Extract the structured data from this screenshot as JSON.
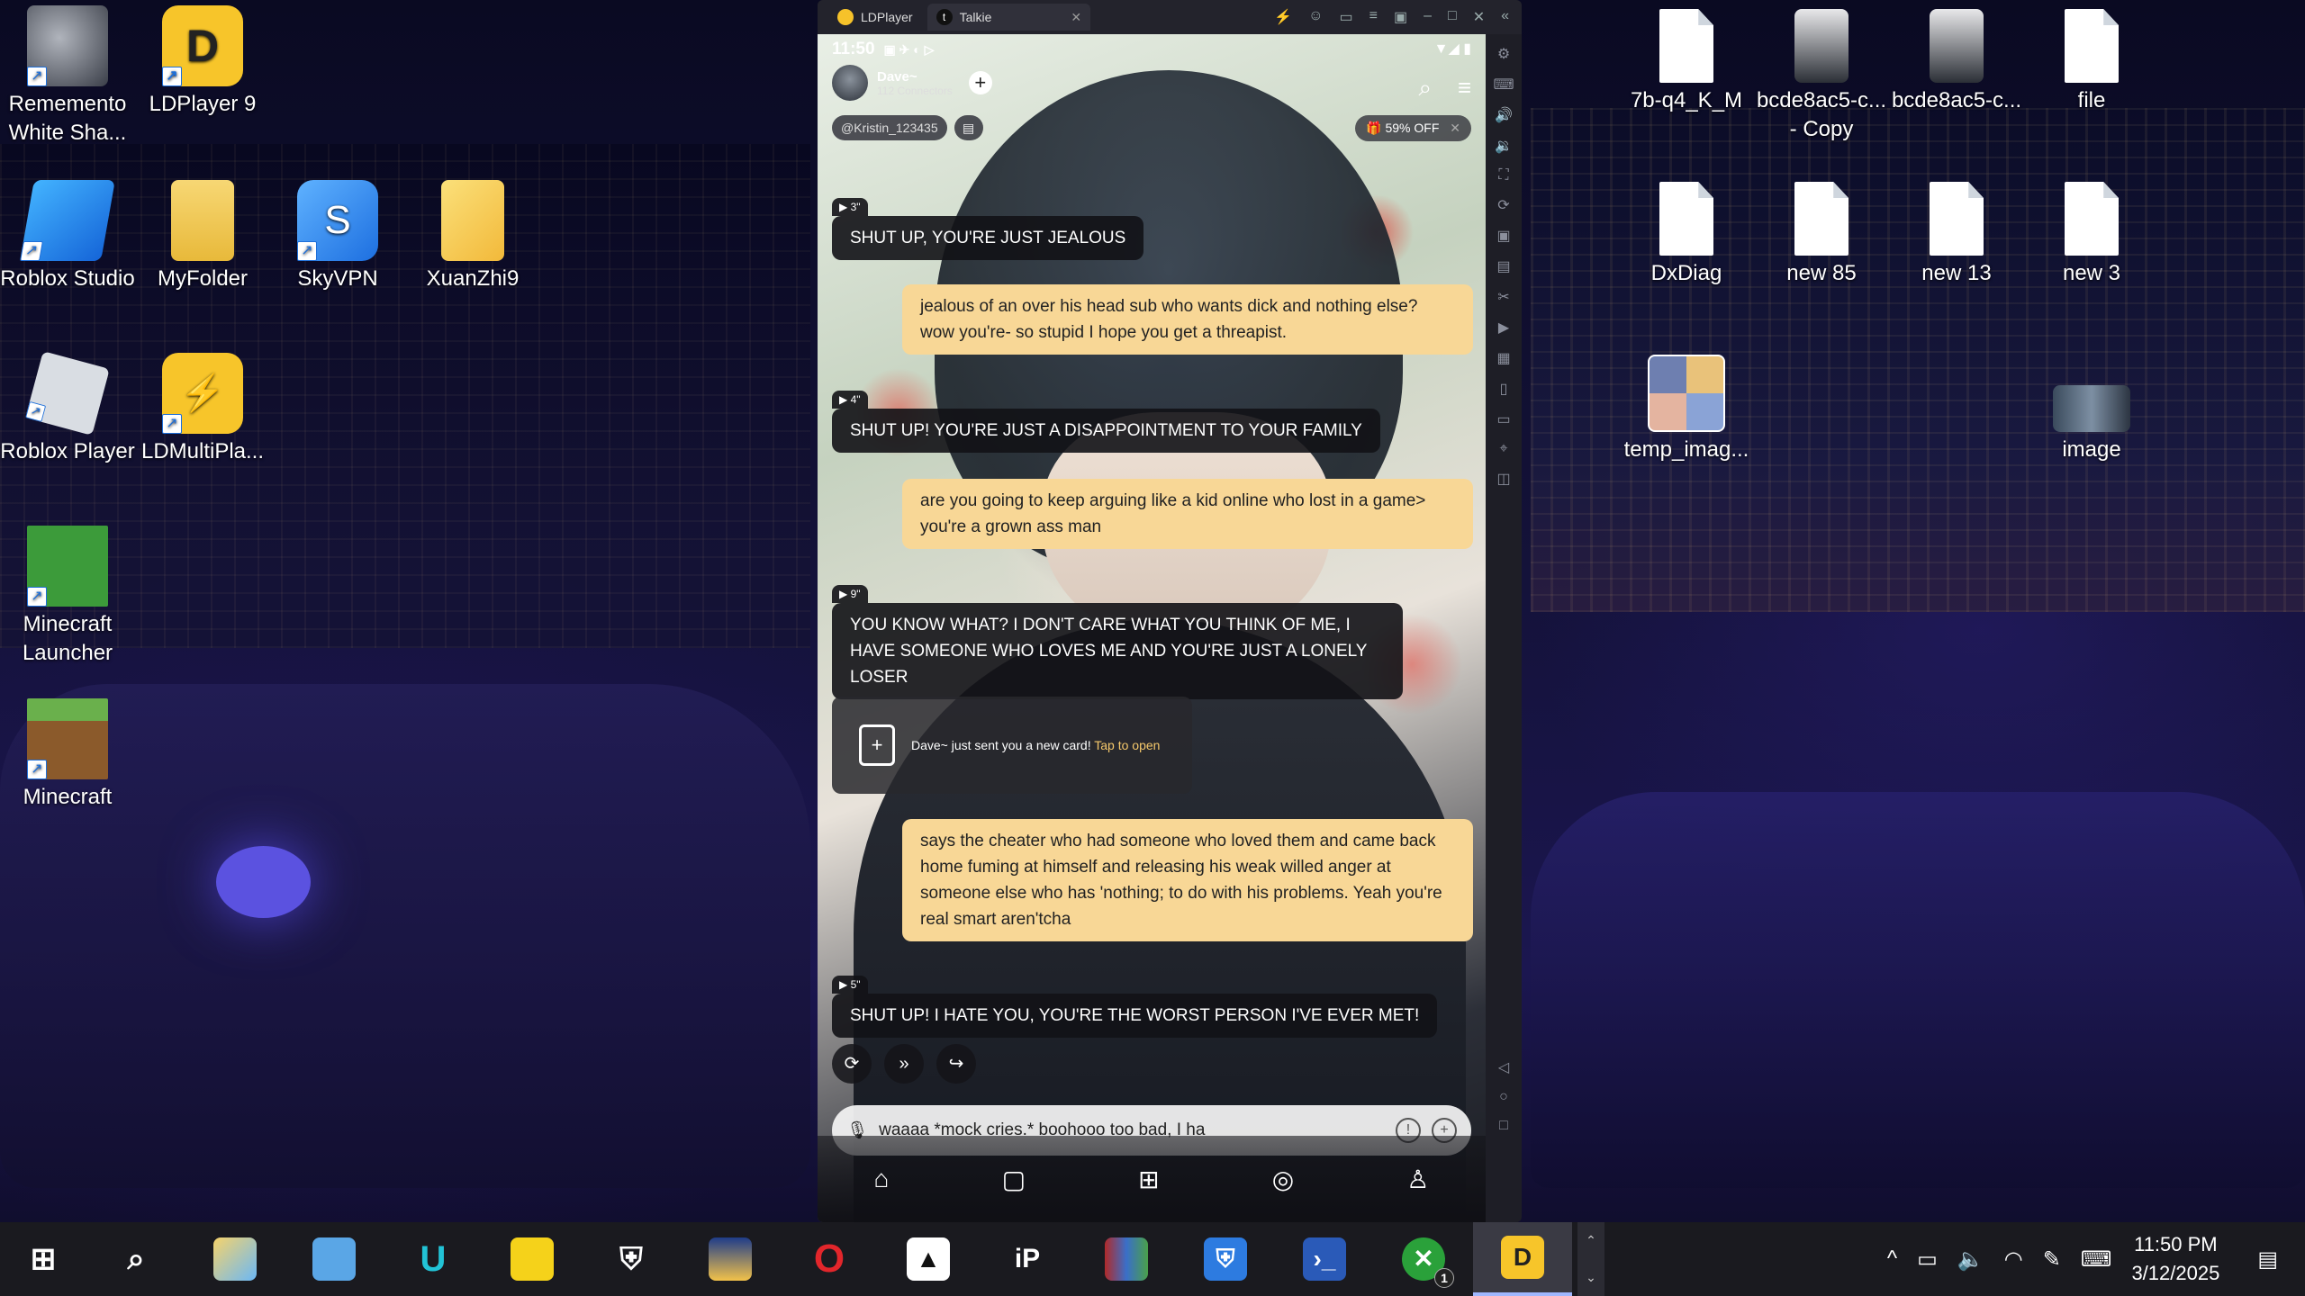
{
  "desktop": {
    "left_icons": [
      {
        "label": "Rememento White Sha...",
        "icon": "rememento-icon",
        "color": "#6b6f7a"
      },
      {
        "label": "LDPlayer 9",
        "icon": "ldplayer-icon",
        "color": "#f7c52a"
      },
      {
        "label": "Roblox Studio",
        "icon": "roblox-studio-icon",
        "color": "#1d8fe8"
      },
      {
        "label": "MyFolder",
        "icon": "folder-icon",
        "color": "#f4cd5a"
      },
      {
        "label": "SkyVPN",
        "icon": "skyvpn-icon",
        "color": "#2d86e6"
      },
      {
        "label": "XuanZhi9",
        "icon": "xuanzhi-icon",
        "color": "#f5d35a"
      },
      {
        "label": "Roblox Player",
        "icon": "roblox-player-icon",
        "color": "#d9dde3"
      },
      {
        "label": "LDMultiPla...",
        "icon": "ldmultiplayer-icon",
        "color": "#f7c52a"
      },
      {
        "label": "Minecraft Launcher",
        "icon": "minecraft-launcher-icon",
        "color": "#3c9b3a"
      },
      {
        "label": "Minecraft",
        "icon": "minecraft-icon",
        "color": "#6a9e3c"
      }
    ],
    "right_icons": [
      {
        "label": "7b-q4_K_M",
        "type": "file"
      },
      {
        "label": "bcde8ac5-c... - Copy",
        "type": "image"
      },
      {
        "label": "bcde8ac5-c...",
        "type": "image"
      },
      {
        "label": "file",
        "type": "file"
      },
      {
        "label": "DxDiag",
        "type": "file"
      },
      {
        "label": "new 85",
        "type": "file"
      },
      {
        "label": "new 13",
        "type": "file"
      },
      {
        "label": "new 3",
        "type": "file"
      },
      {
        "label": "temp_imag...",
        "type": "image"
      },
      {
        "label": "image",
        "type": "image"
      }
    ]
  },
  "ldplayer": {
    "tabs": [
      {
        "label": "LDPlayer",
        "icon": "ldplayer-tab-icon"
      },
      {
        "label": "Talkie",
        "icon": "talkie-tab-icon"
      }
    ]
  },
  "phone": {
    "time": "11:50",
    "profile_name": "Dave~",
    "connectors": "112 Connectors",
    "handle": "@Kristin_123435",
    "promo": "59% OFF",
    "messages": [
      {
        "role": "bot",
        "tag": "▶ 3\"",
        "text": "SHUT UP, YOU'RE JUST JEALOUS"
      },
      {
        "role": "user",
        "text": "jealous of an over his head sub who wants dick and nothing else? wow you're- so stupid I hope you get a threapist."
      },
      {
        "role": "bot",
        "tag": "▶ 4\"",
        "text": "SHUT UP! YOU'RE JUST A DISAPPOINTMENT TO YOUR FAMILY"
      },
      {
        "role": "user",
        "text": "are you going to keep arguing like a kid online who lost in a game> you're a grown ass man"
      },
      {
        "role": "bot",
        "tag": "▶ 9\"",
        "text": "YOU KNOW WHAT? I DON'T CARE WHAT YOU THINK OF ME, I HAVE SOMEONE WHO LOVES ME AND YOU'RE JUST A LONELY LOSER"
      },
      {
        "role": "user",
        "text": "says the cheater who had someone who loved them and came back home fuming at himself and releasing his weak willed anger at someone else who has 'nothing; to do with his problems. Yeah you're real smart aren'tcha"
      },
      {
        "role": "bot",
        "tag": "▶ 5\"",
        "text": "SHUT UP! I HATE YOU, YOU'RE THE WORST PERSON I'VE EVER MET!"
      }
    ],
    "card_text": "Dave~ just sent you a new card!",
    "card_link": "Tap to open",
    "input_value": "waaaa *mock cries.* boohooo too bad, I ha"
  },
  "taskbar": {
    "clock_time": "11:50 PM",
    "clock_date": "3/12/2025",
    "badge": "1"
  }
}
